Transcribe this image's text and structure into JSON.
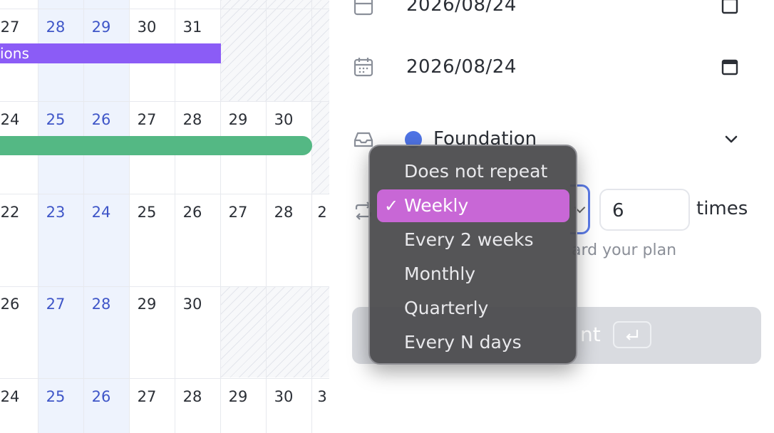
{
  "calendar": {
    "rows": [
      {
        "days": [
          "27",
          "28",
          "29",
          "30",
          "31"
        ]
      },
      {
        "days": [
          "24",
          "25",
          "26",
          "27",
          "28",
          "29",
          "30"
        ]
      },
      {
        "days": [
          "22",
          "23",
          "24",
          "25",
          "26",
          "27",
          "28",
          "2"
        ]
      },
      {
        "days": [
          "26",
          "27",
          "28",
          "29",
          "30"
        ]
      },
      {
        "days": [
          "24",
          "25",
          "26",
          "27",
          "28",
          "29",
          "30",
          "3"
        ]
      }
    ],
    "events": {
      "purple": {
        "label": "ions",
        "color": "#8b5cf6"
      },
      "green": {
        "label": "",
        "color": "#54b884"
      }
    }
  },
  "form": {
    "start_date": "2026/08/24",
    "end_date": "2026/08/24",
    "project": {
      "name": "Foundation",
      "color": "#4f74e6"
    },
    "repeat": {
      "count": "6",
      "times_label": "times",
      "hint": "ard your plan",
      "options": [
        "Does not repeat",
        "Weekly",
        "Every 2 weeks",
        "Monthly",
        "Quarterly",
        "Every N days"
      ],
      "selected": "Weekly",
      "selected_color": "#c867d6"
    },
    "submit": {
      "label_fragment": "nt"
    }
  }
}
